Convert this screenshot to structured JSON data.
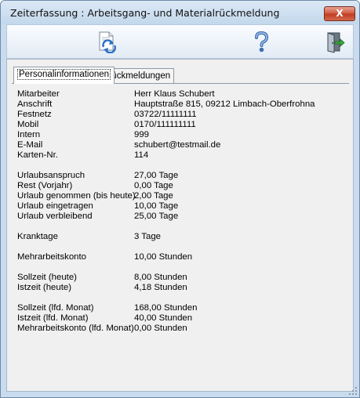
{
  "window": {
    "title": "Zeiterfassung : Arbeitsgang- und Materialrückmeldung",
    "close_label": "X"
  },
  "toolbar": {
    "icons": [
      "refresh-document-icon",
      "help-icon",
      "exit-door-icon"
    ]
  },
  "tabs": [
    {
      "label": "Personalinformationen",
      "active": true
    },
    {
      "label": "Rückmeldungen",
      "active": false
    }
  ],
  "info": {
    "rows": [
      {
        "label": "Mitarbeiter",
        "value": "Herr Klaus Schubert"
      },
      {
        "label": "Anschrift",
        "value": "Hauptstraße 815, 09212 Limbach-Oberfrohna"
      },
      {
        "label": "Festnetz",
        "value": "03722/11111111"
      },
      {
        "label": "Mobil",
        "value": "0170/111111111"
      },
      {
        "label": "Intern",
        "value": "999"
      },
      {
        "label": "E-Mail",
        "value": "schubert@testmail.de"
      },
      {
        "label": "Karten-Nr.",
        "value": "114"
      },
      {
        "label": "Urlaubsanspruch",
        "value": "27,00 Tage"
      },
      {
        "label": "Rest (Vorjahr)",
        "value": "0,00 Tage"
      },
      {
        "label": "Urlaub genommen (bis heute)",
        "value": "2,00 Tage"
      },
      {
        "label": "Urlaub eingetragen",
        "value": "10,00 Tage"
      },
      {
        "label": "Urlaub verbleibend",
        "value": "25,00 Tage"
      },
      {
        "label": "Kranktage",
        "value": "3 Tage"
      },
      {
        "label": "Mehrarbeitskonto",
        "value": "10,00 Stunden"
      },
      {
        "label": "Sollzeit (heute)",
        "value": "8,00 Stunden"
      },
      {
        "label": "Istzeit (heute)",
        "value": "4,18 Stunden"
      },
      {
        "label": "Sollzeit (lfd. Monat)",
        "value": "168,00 Stunden"
      },
      {
        "label": "Istzeit (lfd. Monat)",
        "value": "40,00 Stunden"
      },
      {
        "label": "Mehrarbeitskonto (lfd. Monat)",
        "value": "0,00 Stunden"
      }
    ]
  }
}
